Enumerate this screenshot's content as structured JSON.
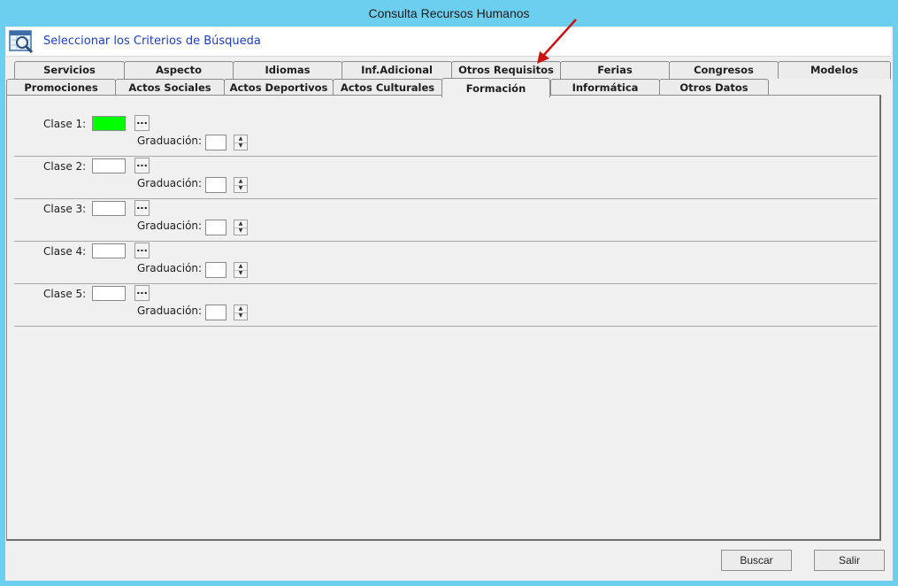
{
  "window": {
    "title": "Consulta Recursos Humanos"
  },
  "header": {
    "icon": "search-calendar-icon",
    "text": "Seleccionar los Criterios de Búsqueda"
  },
  "tabs_row1": [
    {
      "label": "Servicios"
    },
    {
      "label": "Aspecto"
    },
    {
      "label": "Idiomas"
    },
    {
      "label": "Inf.Adicional"
    },
    {
      "label": "Otros Requisitos"
    },
    {
      "label": "Ferias"
    },
    {
      "label": "Congresos"
    },
    {
      "label": "Modelos"
    }
  ],
  "tabs_row2": [
    {
      "label": "Promociones"
    },
    {
      "label": "Actos Sociales"
    },
    {
      "label": "Actos Deportivos"
    },
    {
      "label": "Actos Culturales"
    },
    {
      "label": "Formación",
      "active": true
    },
    {
      "label": "Informática"
    },
    {
      "label": "Otros Datos"
    }
  ],
  "rows": [
    {
      "label": "Clase 1:",
      "browse": "...",
      "grad_label": "Graduación:",
      "value": "",
      "grad": "",
      "selected": true
    },
    {
      "label": "Clase 2:",
      "browse": "...",
      "grad_label": "Graduación:",
      "value": "",
      "grad": ""
    },
    {
      "label": "Clase 3:",
      "browse": "...",
      "grad_label": "Graduación:",
      "value": "",
      "grad": ""
    },
    {
      "label": "Clase 4:",
      "browse": "...",
      "grad_label": "Graduación:",
      "value": "",
      "grad": ""
    },
    {
      "label": "Clase 5:",
      "browse": "...",
      "grad_label": "Graduación:",
      "value": "",
      "grad": ""
    }
  ],
  "buttons": {
    "search": "Buscar",
    "exit": "Salir"
  },
  "colors": {
    "selected_field": "#00ff00",
    "header_text": "#1a3ccc",
    "annotation_arrow": "#cc1111"
  }
}
